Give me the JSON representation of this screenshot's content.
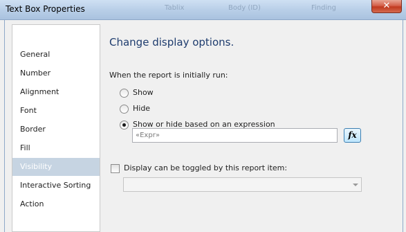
{
  "window": {
    "title": "Text Box Properties",
    "close_glyph": "✕",
    "background_tabs": [
      "Tablix",
      "Body (ID)",
      "Finding"
    ]
  },
  "sidebar": {
    "items": [
      {
        "label": "General",
        "selected": false
      },
      {
        "label": "Number",
        "selected": false
      },
      {
        "label": "Alignment",
        "selected": false
      },
      {
        "label": "Font",
        "selected": false
      },
      {
        "label": "Border",
        "selected": false
      },
      {
        "label": "Fill",
        "selected": false
      },
      {
        "label": "Visibility",
        "selected": true
      },
      {
        "label": "Interactive Sorting",
        "selected": false
      },
      {
        "label": "Action",
        "selected": false
      }
    ]
  },
  "main": {
    "heading": "Change display options.",
    "initial_run_label": "When the report is initially run:",
    "options": [
      {
        "label": "Show",
        "checked": false
      },
      {
        "label": "Hide",
        "checked": false
      },
      {
        "label": "Show or hide based on an expression",
        "checked": true
      }
    ],
    "expression": {
      "value": "«Expr»",
      "fx_label": "fx"
    },
    "toggle": {
      "label": "Display can be toggled by this report item:",
      "checked": false,
      "selected_value": ""
    }
  },
  "colors": {
    "selected_item_bg": "#c6d4e2",
    "heading": "#1e3c6e",
    "close_button": "#c1391f"
  }
}
